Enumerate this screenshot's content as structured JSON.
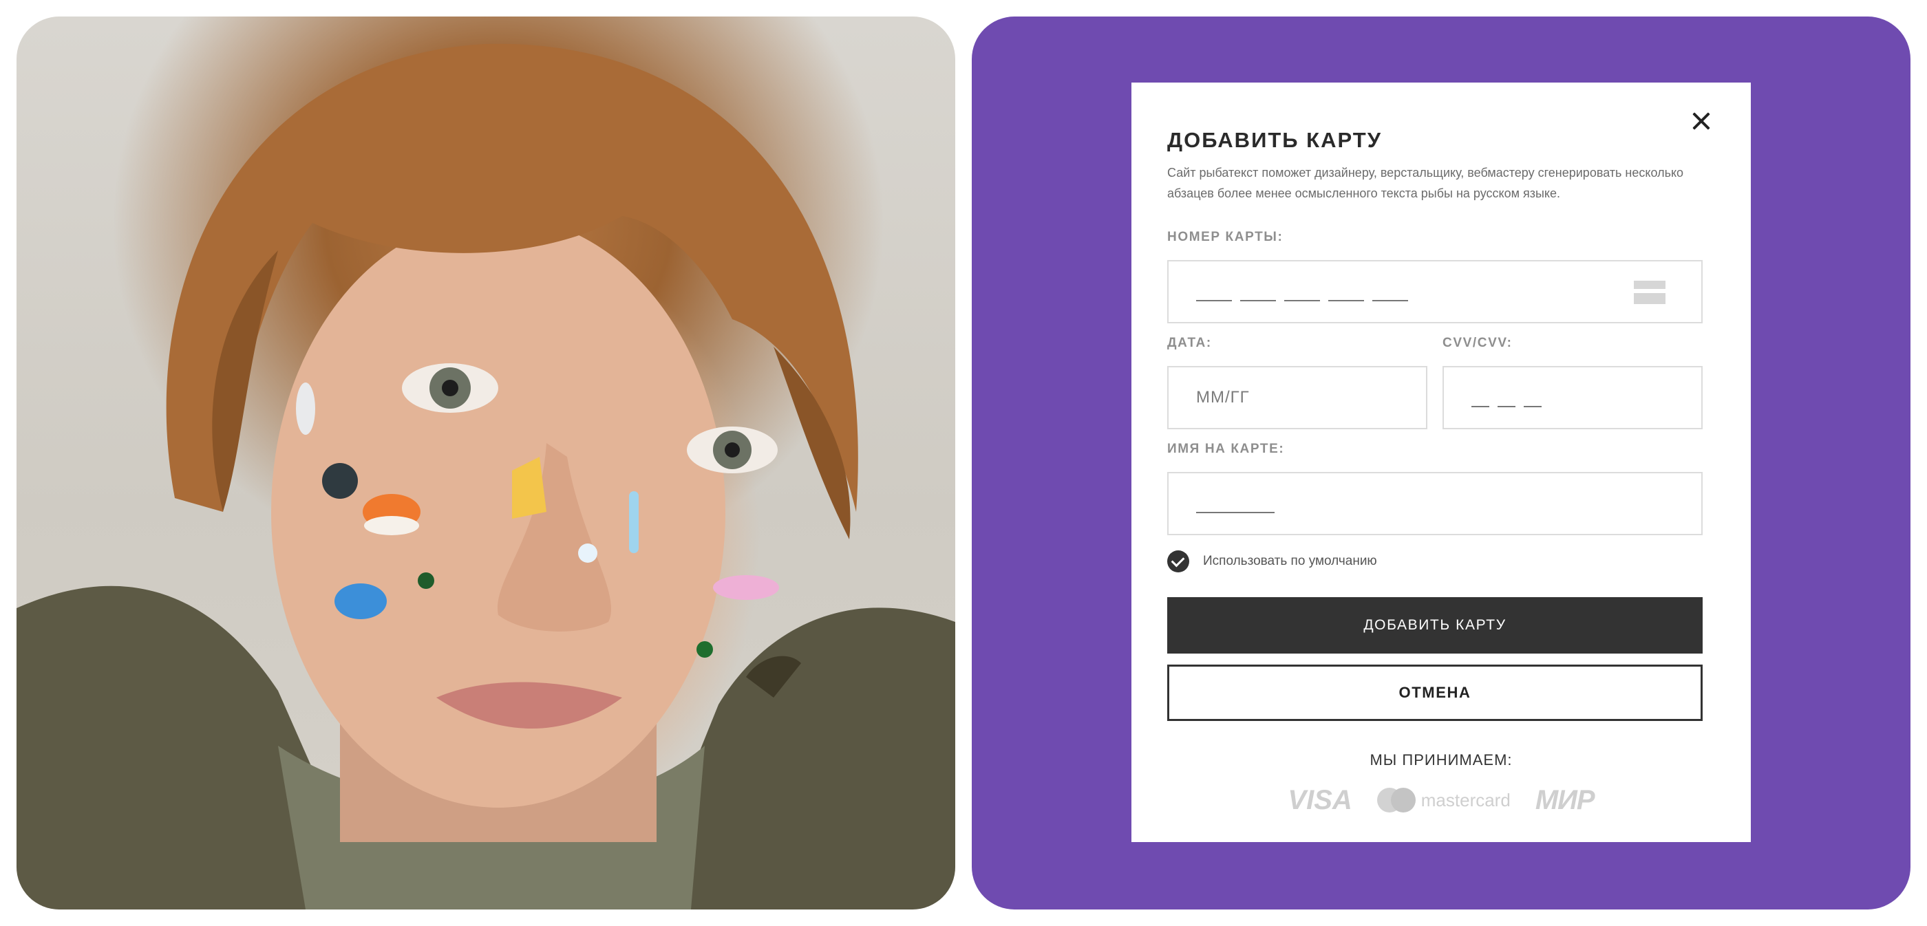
{
  "modal": {
    "title": "ДОБАВИТЬ КАРТУ",
    "description": "Сайт рыбатекст поможет дизайнеру, верстальщику, вебмастеру сгенерировать несколько абзацев более менее осмысленного текста рыбы на русском языке.",
    "close_icon": "close-icon"
  },
  "card_number": {
    "label": "НОМЕР КАРТЫ:",
    "placeholder_groups": 5,
    "icon": "card-icon"
  },
  "date": {
    "label": "ДАТА:",
    "placeholder": "ММ/ГГ"
  },
  "cvv": {
    "label": "CVV/CVV:",
    "placeholder_groups": 3
  },
  "cardholder": {
    "label": "ИМЯ НА КАРТЕ:"
  },
  "default_option": {
    "label": "Использовать по умолчанию",
    "checked": true
  },
  "buttons": {
    "add": "ДОБАВИТЬ КАРТУ",
    "cancel": "ОТМЕНА"
  },
  "accepted": {
    "title": "МЫ ПРИНИМАЕМ:",
    "visa": "VISA",
    "mastercard": "mastercard",
    "mir": "МИР"
  },
  "colors": {
    "panel_purple": "#6f4bb0",
    "button_dark": "#333333"
  }
}
